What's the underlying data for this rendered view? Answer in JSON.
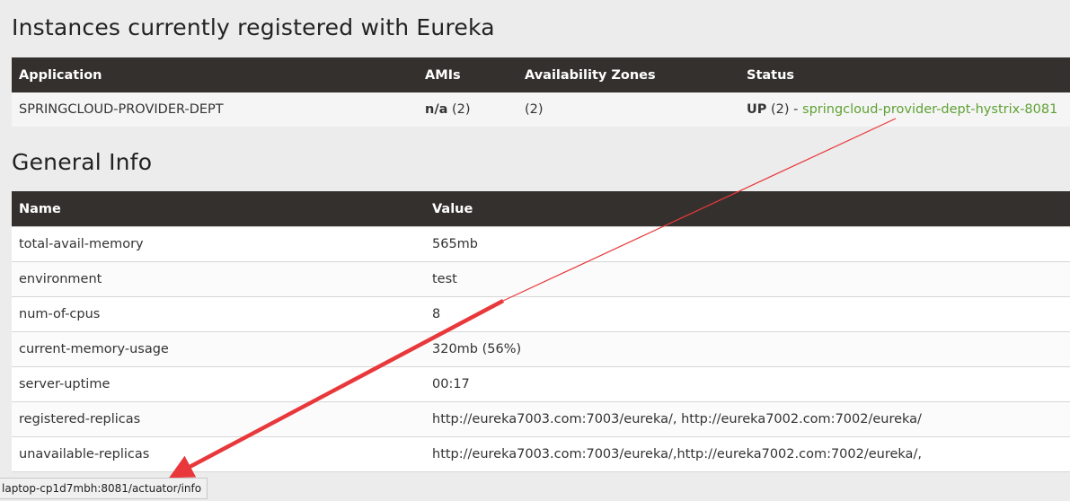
{
  "instances": {
    "title": "Instances currently registered with Eureka",
    "headers": [
      "Application",
      "AMIs",
      "Availability Zones",
      "Status"
    ],
    "row": {
      "application": "SPRINGCLOUD-PROVIDER-DEPT",
      "amis_bold": "n/a",
      "amis_count": " (2)",
      "zones": "(2)",
      "status_bold": "UP",
      "status_count": " (2) - ",
      "status_link": "springcloud-provider-dept-hystrix-8081"
    }
  },
  "general": {
    "title": "General Info",
    "headers": [
      "Name",
      "Value"
    ],
    "rows": [
      {
        "name": "total-avail-memory",
        "value": "565mb"
      },
      {
        "name": "environment",
        "value": "test"
      },
      {
        "name": "num-of-cpus",
        "value": "8"
      },
      {
        "name": "current-memory-usage",
        "value": "320mb (56%)"
      },
      {
        "name": "server-uptime",
        "value": "00:17"
      },
      {
        "name": "registered-replicas",
        "value": "http://eureka7003.com:7003/eureka/, http://eureka7002.com:7002/eureka/"
      },
      {
        "name": "unavailable-replicas",
        "value": "http://eureka7003.com:7003/eureka/,http://eureka7002.com:7002/eureka/,"
      }
    ]
  },
  "status_bar": {
    "url": "laptop-cp1d7mbh:8081/actuator/info"
  },
  "colors": {
    "header_bg": "#34302d",
    "link": "#5fa134",
    "annotation_arrow": "#e8383b"
  }
}
